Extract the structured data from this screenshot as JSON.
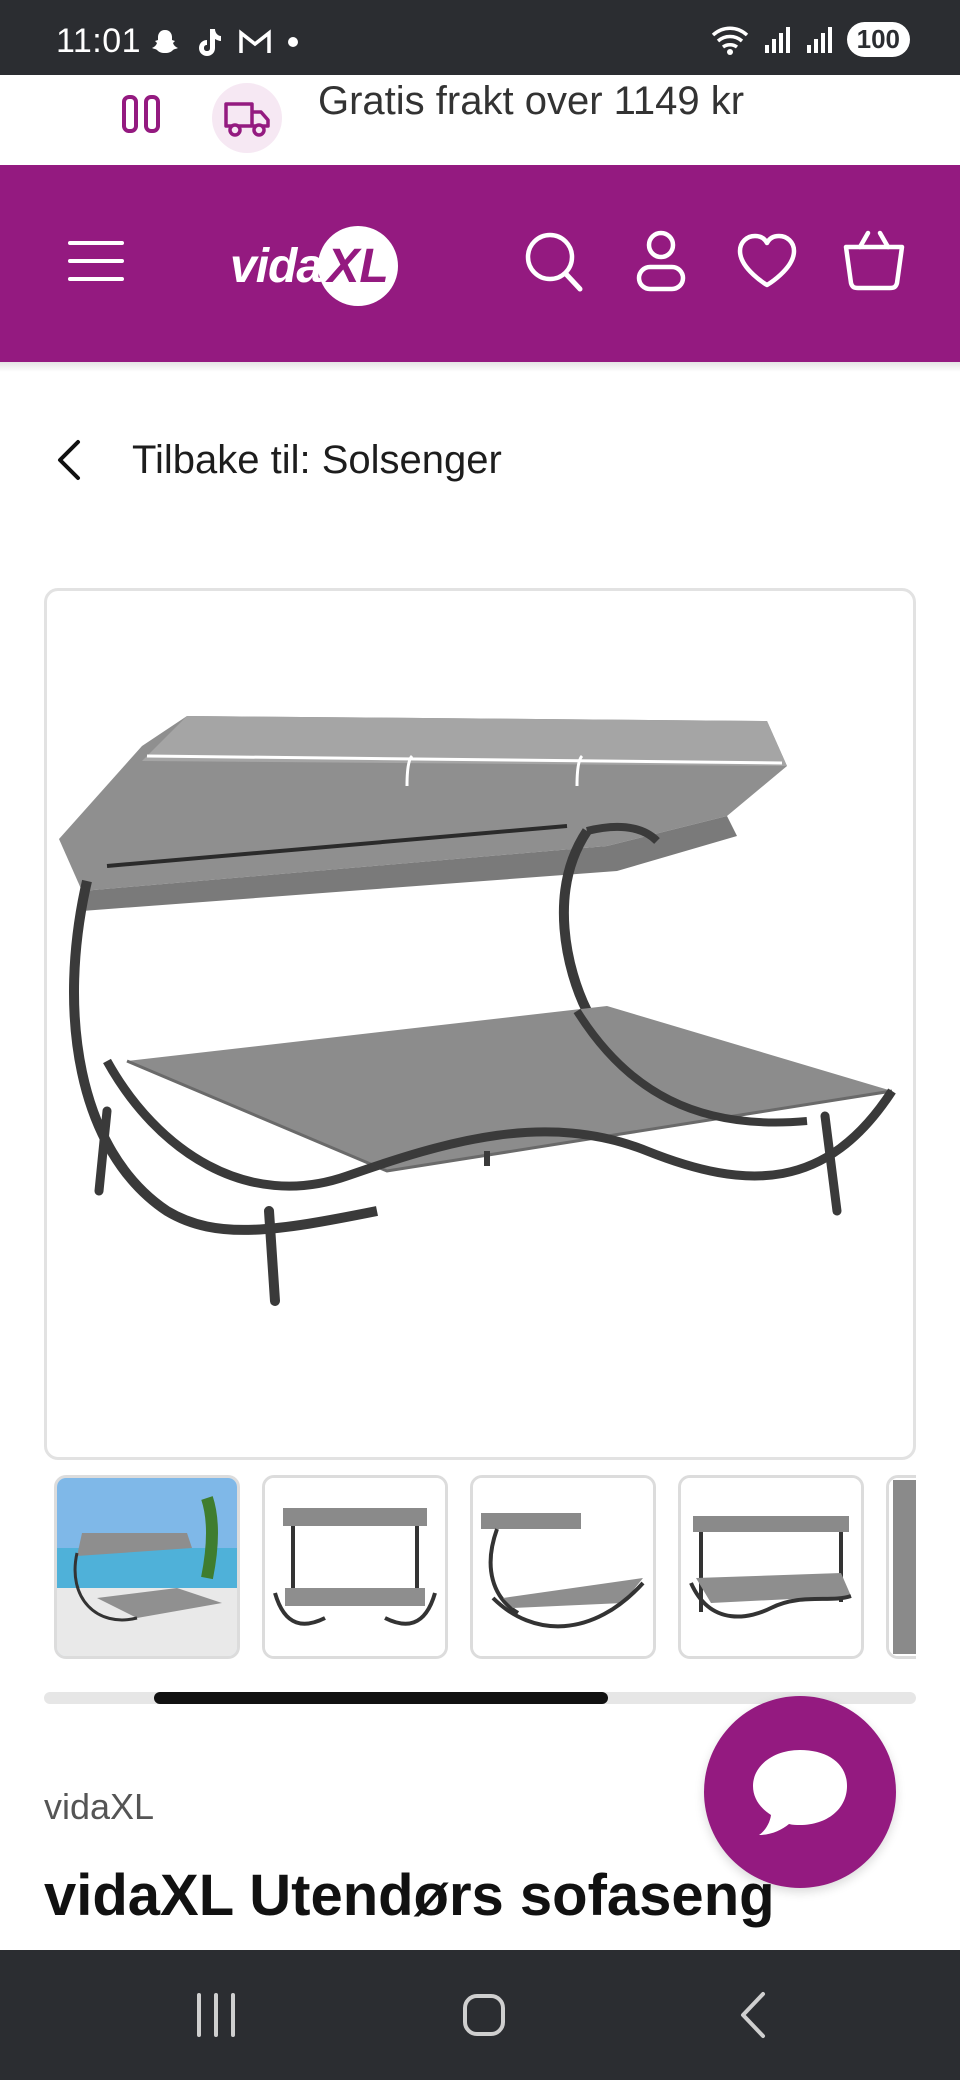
{
  "status_bar": {
    "time": "11:01",
    "battery": "100",
    "notification_icons": [
      "snapchat-icon",
      "tiktok-icon",
      "gmail-icon",
      "dot-icon"
    ],
    "system_icons": [
      "wifi-icon",
      "signal-icon",
      "signal-icon-2"
    ]
  },
  "promo": {
    "text": "Gratis frakt over 1149 kr"
  },
  "header": {
    "logo_text": "vida",
    "logo_xl": "XL",
    "icons": [
      "menu-icon",
      "search-icon",
      "account-icon",
      "heart-icon",
      "basket-icon"
    ],
    "background_color": "#941a80"
  },
  "breadcrumb": {
    "label": "Tilbake til: Solsenger"
  },
  "gallery": {
    "thumbnail_count_visible": 4,
    "scroll_position": 0.2
  },
  "product": {
    "brand": "vidaXL",
    "title": "vidaXL Utendørs sofaseng"
  },
  "nav_bar": {
    "buttons": [
      "recents-icon",
      "home-icon",
      "back-icon"
    ]
  },
  "colors": {
    "brand": "#941a80",
    "statusbar": "#2b2d31"
  }
}
